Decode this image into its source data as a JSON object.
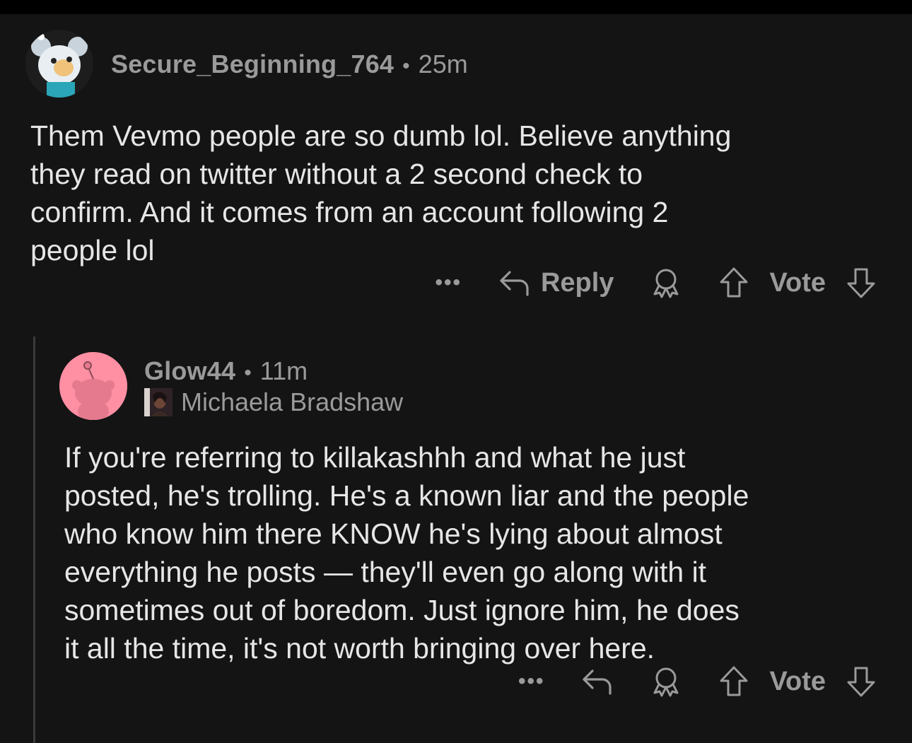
{
  "comment1": {
    "username": "Secure_Beginning_764",
    "separator": "•",
    "time": "25m",
    "body": "Them Vevmo people are so dumb lol. Believe anything\nthey read on twitter without a 2 second check to\nconfirm. And it comes from an account following 2\npeople lol",
    "more": "•••",
    "reply_label": "Reply",
    "vote_label": "Vote"
  },
  "comment2": {
    "username": "Glow44",
    "separator": "•",
    "time": "11m",
    "flair": "Michaela Bradshaw",
    "body": "If you're referring to killakashhh and what he just\nposted, he's trolling. He's a known liar and the people\nwho know him there KNOW he's lying about almost\neverything he posts — they'll even go along with it\nsometimes out of boredom. Just ignore him, he does\nit all the time, it's not worth bringing over here.",
    "more": "•••",
    "vote_label": "Vote"
  },
  "icons": {
    "reply": "reply-arrow-icon",
    "award": "award-icon",
    "upvote": "upvote-arrow-icon",
    "downvote": "downvote-arrow-icon",
    "more": "more-dots-icon"
  },
  "colors": {
    "background": "#141414",
    "text": "#e6e6e6",
    "muted": "#9a9a9a",
    "avatar2_bg": "#ff8fa3"
  }
}
